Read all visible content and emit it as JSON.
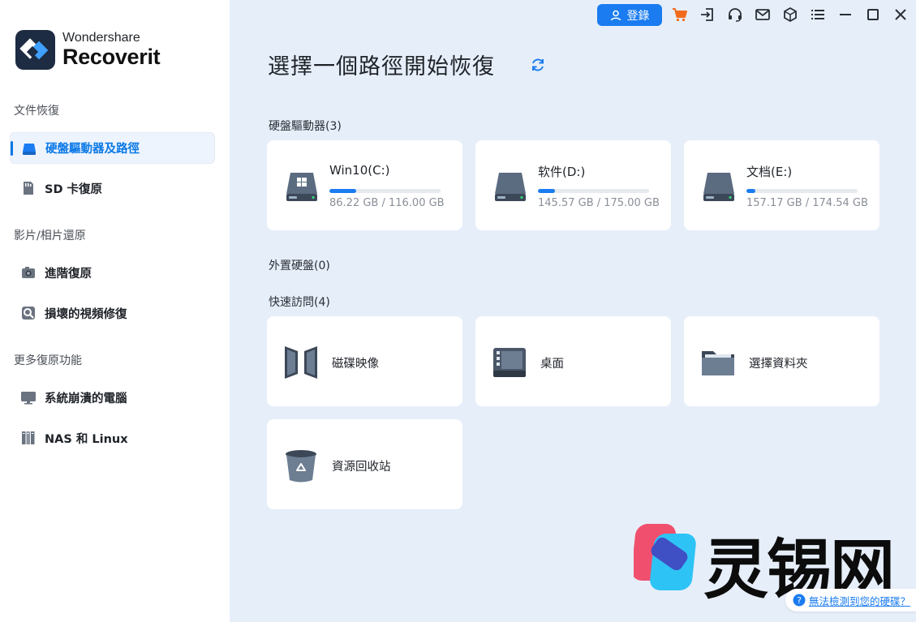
{
  "app": {
    "brand": "Wondershare",
    "product": "Recoverit"
  },
  "sidebar": {
    "sections": [
      {
        "title": "文件恢復"
      },
      {
        "title": "影片/相片還原"
      },
      {
        "title": "更多復原功能"
      }
    ],
    "items": [
      {
        "label": "硬盤驅動器及路徑",
        "icon": "hard-drive-icon",
        "active": true
      },
      {
        "label": "SD 卡復原",
        "icon": "sd-card-icon"
      },
      {
        "label": "進階復原",
        "icon": "camera-icon"
      },
      {
        "label": "損壞的視頻修復",
        "icon": "video-repair-icon"
      },
      {
        "label": "系統崩潰的電腦",
        "icon": "monitor-icon"
      },
      {
        "label": "NAS 和 Linux",
        "icon": "nas-icon"
      }
    ]
  },
  "topbar": {
    "login_label": "登錄",
    "icons": [
      "user-icon",
      "cart-icon",
      "sign-in-icon",
      "headset-icon",
      "mail-icon",
      "cube-icon",
      "menu-icon",
      "minimize-icon",
      "maximize-icon",
      "close-icon"
    ]
  },
  "main": {
    "title": "選擇一個路徑開始恢復",
    "hard_drives_label": "硬盤驅動器(3)",
    "external_label": "外置硬盤(0)",
    "quick_access_label": "快速訪問(4)",
    "drives": [
      {
        "name": "Win10(C:)",
        "size": "86.22 GB / 116.00 GB",
        "used_fraction": 0.24,
        "icon": "windows-drive-icon"
      },
      {
        "name": "软件(D:)",
        "size": "145.57 GB / 175.00 GB",
        "used_fraction": 0.15,
        "icon": "drive-icon"
      },
      {
        "name": "文档(E:)",
        "size": "157.17 GB / 174.54 GB",
        "used_fraction": 0.08,
        "icon": "drive-icon"
      }
    ],
    "quick_access": [
      {
        "label": "磁碟映像",
        "icon": "disk-image-icon"
      },
      {
        "label": "桌面",
        "icon": "desktop-icon"
      },
      {
        "label": "選擇資料夾",
        "icon": "folder-icon"
      },
      {
        "label": "資源回收站",
        "icon": "recycle-bin-icon"
      }
    ]
  },
  "watermark": {
    "text": "灵锡网"
  },
  "help_link": {
    "label": "無法檢測到您的硬碟？"
  },
  "colors": {
    "accent": "#1a7cf0",
    "background": "#e6eef9",
    "sidebar": "#ffffff",
    "cart": "#f26b1d"
  }
}
